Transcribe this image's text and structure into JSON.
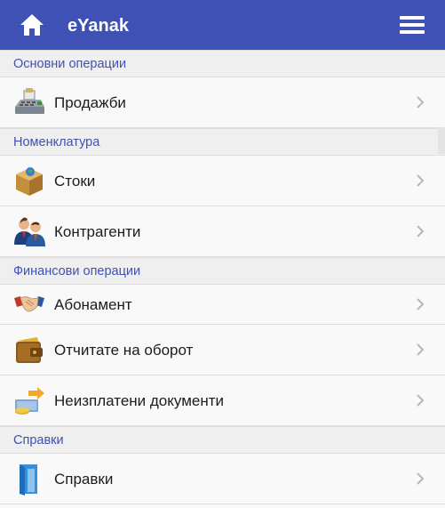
{
  "header": {
    "title": "eYanak",
    "accent": "#3f51b5"
  },
  "sections": [
    {
      "label": "Основни операции"
    },
    {
      "label": "Номенклатура"
    },
    {
      "label": "Финансови операции"
    },
    {
      "label": "Справки"
    }
  ],
  "items": [
    {
      "label": "Продажби",
      "icon": "cash-register-icon"
    },
    {
      "label": "Стоки",
      "icon": "goods-box-icon"
    },
    {
      "label": "Контрагенти",
      "icon": "partners-people-icon"
    },
    {
      "label": "Абонамент",
      "icon": "handshake-icon"
    },
    {
      "label": "Отчитате на оборот",
      "icon": "wallet-icon"
    },
    {
      "label": "Неизплатени документи",
      "icon": "money-arrow-icon"
    },
    {
      "label": "Справки",
      "icon": "reports-book-icon"
    }
  ]
}
